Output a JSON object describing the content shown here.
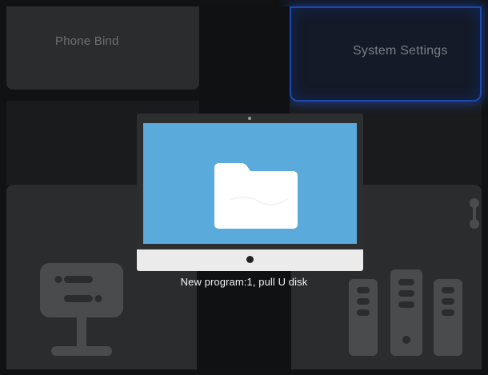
{
  "tiles": {
    "phone_bind": {
      "label": "Phone Bind"
    },
    "system_settings": {
      "label": "System Settings",
      "focused": true,
      "focus_color": "#1b49ad"
    },
    "bottom_left": {
      "icon": "network-terminal-icon"
    },
    "bottom_right": {
      "icon": "server-rack-icon"
    }
  },
  "dialog": {
    "icon": "folder-icon",
    "screen_color": "#5aaadc",
    "message": "New program:1, pull U disk"
  }
}
